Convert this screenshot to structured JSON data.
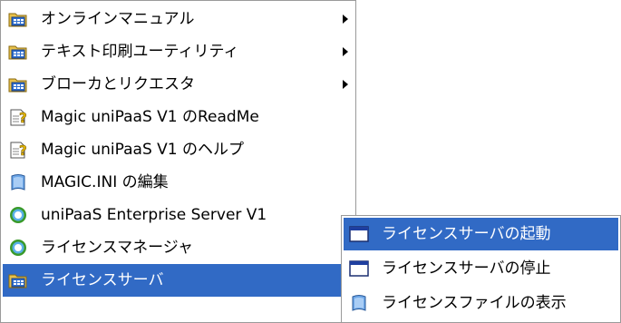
{
  "main_menu": {
    "items": [
      {
        "label": "オンラインマニュアル",
        "icon": "program-group-folder-icon",
        "has_submenu": true,
        "selected": false
      },
      {
        "label": "テキスト印刷ユーティリティ",
        "icon": "program-group-folder-icon",
        "has_submenu": true,
        "selected": false
      },
      {
        "label": "ブローカとリクエスタ",
        "icon": "program-group-folder-icon",
        "has_submenu": true,
        "selected": false
      },
      {
        "label": "Magic uniPaaS V1 のReadMe",
        "icon": "help-document-icon",
        "has_submenu": false,
        "selected": false
      },
      {
        "label": "Magic uniPaaS V1 のヘルプ",
        "icon": "help-document-icon",
        "has_submenu": false,
        "selected": false
      },
      {
        "label": "MAGIC.INI の編集",
        "icon": "ini-file-icon",
        "has_submenu": false,
        "selected": false
      },
      {
        "label": "uniPaaS Enterprise Server V1",
        "icon": "unipaas-app-icon",
        "has_submenu": false,
        "selected": false
      },
      {
        "label": "ライセンスマネージャ",
        "icon": "unipaas-app-icon",
        "has_submenu": false,
        "selected": false
      },
      {
        "label": "ライセンスサーバ",
        "icon": "program-group-folder-icon",
        "has_submenu": true,
        "selected": true
      }
    ]
  },
  "sub_menu": {
    "items": [
      {
        "label": "ライセンスサーバの起動",
        "icon": "window-app-icon",
        "selected": true
      },
      {
        "label": "ライセンスサーバの停止",
        "icon": "window-app-icon",
        "selected": false
      },
      {
        "label": "ライセンスファイルの表示",
        "icon": "document-file-icon",
        "selected": false
      }
    ]
  },
  "colors": {
    "selection_bg": "#316ac5",
    "selection_text": "#ffffff",
    "menu_border": "#9a9a9a"
  }
}
